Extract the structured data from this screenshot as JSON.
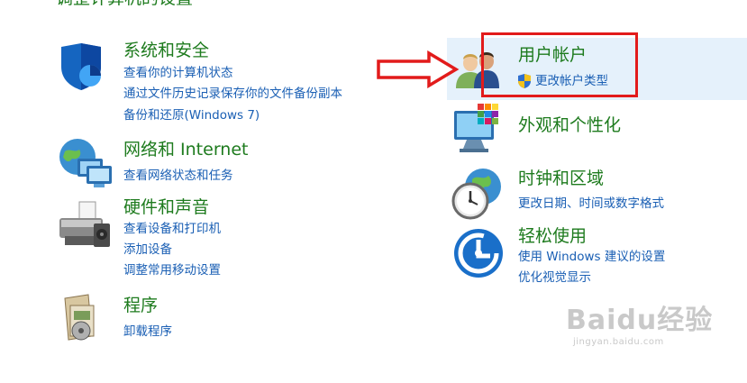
{
  "header_partial": "调整计算机的设置",
  "left": {
    "system": {
      "title": "系统和安全",
      "links": [
        "查看你的计算机状态",
        "通过文件历史记录保存你的文件备份副本",
        "备份和还原(Windows 7)"
      ]
    },
    "network": {
      "title": "网络和 Internet",
      "links": [
        "查看网络状态和任务"
      ]
    },
    "hardware": {
      "title": "硬件和声音",
      "links": [
        "查看设备和打印机",
        "添加设备",
        "调整常用移动设置"
      ]
    },
    "programs": {
      "title": "程序",
      "links": [
        "卸载程序"
      ]
    }
  },
  "right": {
    "accounts": {
      "title": "用户帐户",
      "links": [
        "更改帐户类型"
      ]
    },
    "appearance": {
      "title": "外观和个性化",
      "links": []
    },
    "clock": {
      "title": "时钟和区域",
      "links": [
        "更改日期、时间或数字格式"
      ]
    },
    "ease": {
      "title": "轻松使用",
      "links": [
        "使用 Windows 建议的设置",
        "优化视觉显示"
      ]
    }
  },
  "watermark": {
    "brand": "Baidu经验",
    "url": "jingyan.baidu.com"
  },
  "colors": {
    "category_title": "#1e7b1e",
    "link": "#1a5fb4",
    "highlight_bg": "#e5f1fb",
    "annotation_red": "#e21b1b"
  }
}
